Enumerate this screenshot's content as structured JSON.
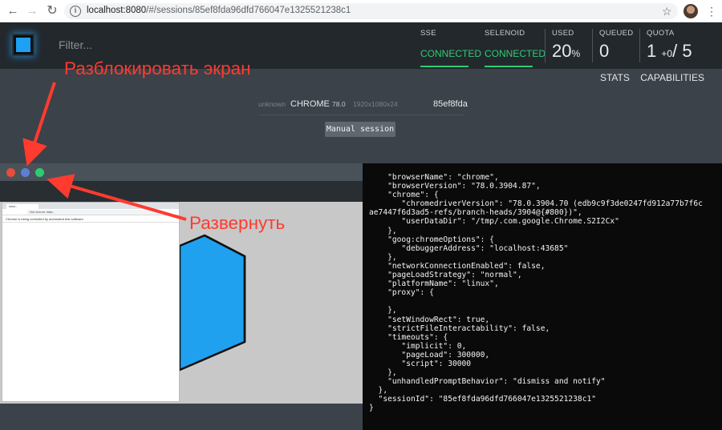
{
  "browser": {
    "url_host": "localhost:8080",
    "url_path": "/#/sessions/85ef8fda96dfd766047e1325521238c1"
  },
  "header": {
    "filter_placeholder": "Filter...",
    "sse_label": "SSE",
    "sse_status": "CONNECTED",
    "selenoid_label": "SELENOID",
    "selenoid_status": "CONNECTED",
    "used_label": "USED",
    "used_value": "20",
    "used_unit": "%",
    "queued_label": "QUEUED",
    "queued_value": "0",
    "quota_label": "QUOTA",
    "quota_used": "1",
    "quota_pending": "+0",
    "quota_sep": "/",
    "quota_total": "5",
    "status_color": "#2ecc71"
  },
  "nav": {
    "stats": "STATS",
    "capabilities": "CAPABILITIES"
  },
  "session": {
    "platform": "unknown",
    "browser": "CHROME",
    "version": "78.0",
    "resolution": "1920x1080x24",
    "id_short": "85ef8fda",
    "manual_label": "Manual session"
  },
  "vnc": {
    "dot_colors": [
      "#e74c3c",
      "#5b7fd6",
      "#2ecc71"
    ],
    "inner_tab_title": "data:,",
    "inner_address": "Not secure  data:,",
    "inner_infobar": "Chrome is being controlled by automated test software.",
    "cube_color": "#1fa1f0"
  },
  "capabilities_text": "    \"browserName\": \"chrome\",\n    \"browserVersion\": \"78.0.3904.87\",\n    \"chrome\": {\n       \"chromedriverVersion\": \"78.0.3904.70 (edb9c9f3de0247fd912a77b7f6c\nae7447f6d3ad5-refs/branch-heads/3904@{#800})\",\n       \"userDataDir\": \"/tmp/.com.google.Chrome.S2I2Cx\"\n    },\n    \"goog:chromeOptions\": {\n       \"debuggerAddress\": \"localhost:43685\"\n    },\n    \"networkConnectionEnabled\": false,\n    \"pageLoadStrategy\": \"normal\",\n    \"platformName\": \"linux\",\n    \"proxy\": {\n\n    },\n    \"setWindowRect\": true,\n    \"strictFileInteractability\": false,\n    \"timeouts\": {\n       \"implicit\": 0,\n       \"pageLoad\": 300000,\n       \"script\": 30000\n    },\n    \"unhandledPromptBehavior\": \"dismiss and notify\"\n  },\n  \"sessionId\": \"85ef8fda96dfd766047e1325521238c1\"\n}",
  "annotations": {
    "unlock": "Разблокировать экран",
    "expand": "Развернуть",
    "color": "#ff3b2f"
  }
}
